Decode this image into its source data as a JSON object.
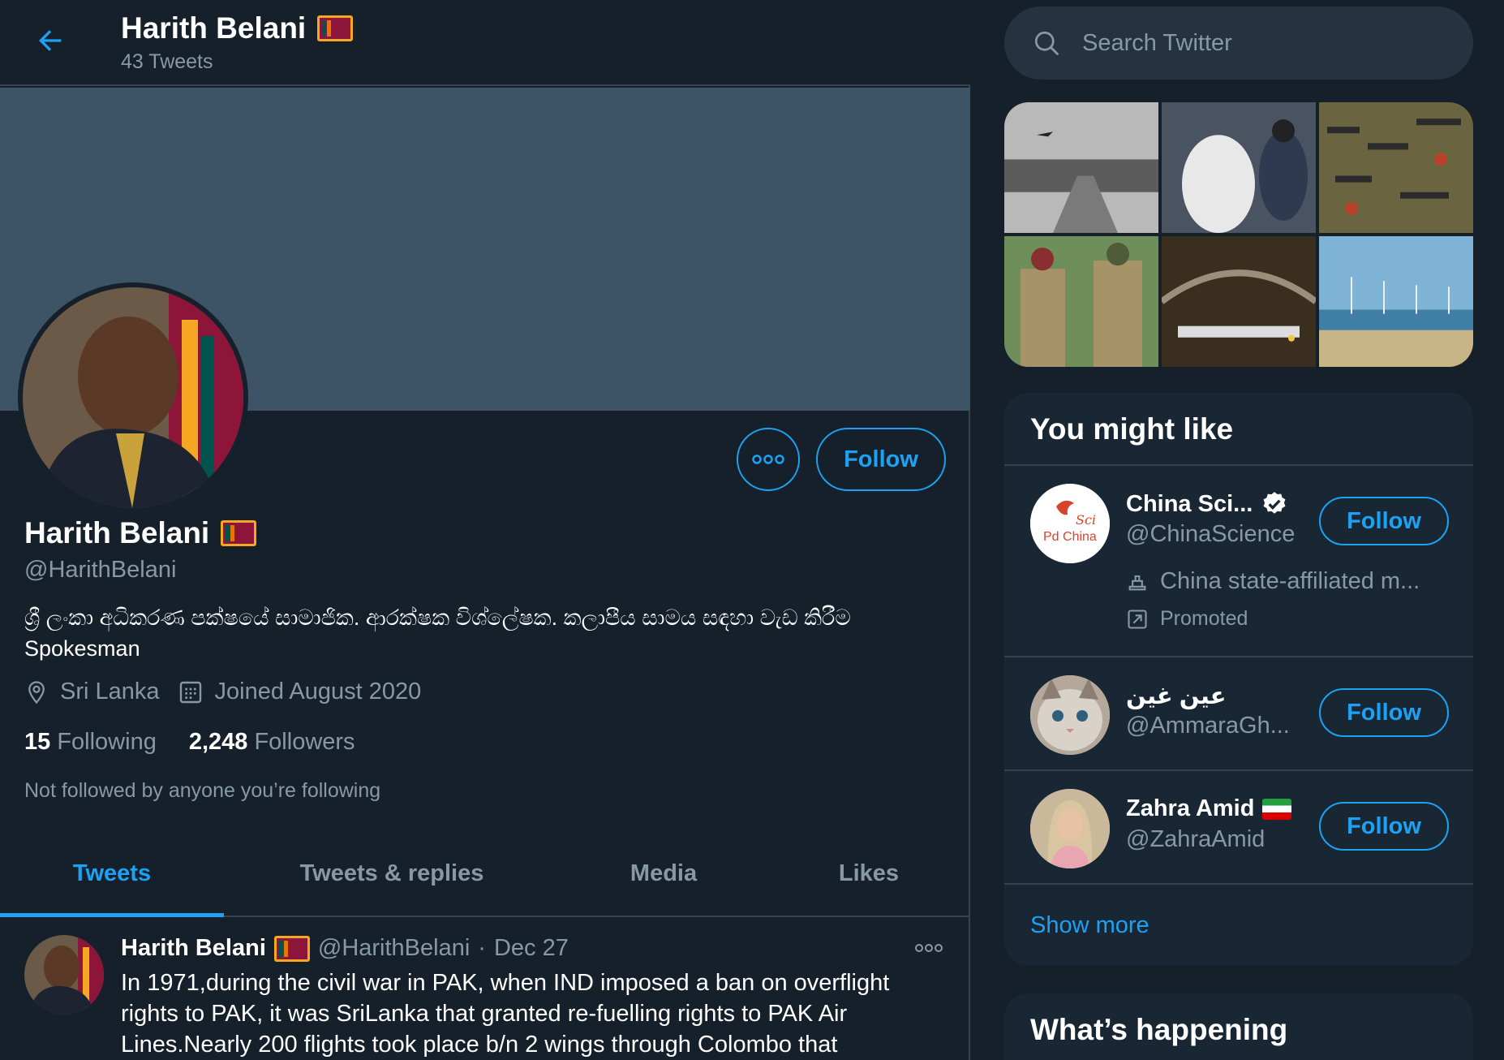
{
  "header": {
    "name": "Harith Belani",
    "tweet_count": "43 Tweets"
  },
  "profile": {
    "name": "Harith Belani",
    "handle": "@HarithBelani",
    "bio_line1": "ශ්‍රී ලංකා අධිකරණ පක්ෂයේ සාමාජික.  ආරක්ෂක විශ්ලේෂක.  කලාපීය සාමය සඳහා වැඩ කිරීම",
    "bio_line2": "Spokesman",
    "location": "Sri Lanka",
    "joined": "Joined August 2020",
    "following_count": "15",
    "following_label": "Following",
    "followers_count": "2,248",
    "followers_label": "Followers",
    "not_followed": "Not followed by anyone you’re following",
    "follow_label": "Follow"
  },
  "tabs": [
    {
      "label": "Tweets",
      "active": true
    },
    {
      "label": "Tweets & replies",
      "active": false
    },
    {
      "label": "Media",
      "active": false
    },
    {
      "label": "Likes",
      "active": false
    }
  ],
  "tweet": {
    "name": "Harith Belani",
    "handle": "@HarithBelani",
    "separator": "·",
    "date": "Dec 27",
    "text": "In 1971,during the civil war in PAK, when IND imposed a ban on overflight rights to PAK, it was SriLanka that granted re-fuelling rights to PAK Air Lines.Nearly 200 flights took place b/n 2 wings through Colombo that"
  },
  "sidebar": {
    "search_placeholder": "Search Twitter",
    "you_might_like": "You might like",
    "suggestions": [
      {
        "name": "China Sci...",
        "handle": "@ChinaScience",
        "verified": true,
        "affiliation": "China state-affiliated m...",
        "promoted": "Promoted",
        "follow": "Follow",
        "avatar_text_1": "Sci",
        "avatar_text_2": "Pd China"
      },
      {
        "name": "عين غين",
        "handle": "@AmmaraGh...",
        "follow": "Follow"
      },
      {
        "name": "Zahra Amid",
        "handle": "@ZahraAmid",
        "follow": "Follow"
      }
    ],
    "show_more": "Show more",
    "whats_happening": "What’s happening"
  },
  "colors": {
    "background": "#15202b",
    "accent": "#1da1f2",
    "secondary_text": "#8899a6",
    "banner": "#3d5466",
    "card": "#192734",
    "border": "#38444d"
  }
}
